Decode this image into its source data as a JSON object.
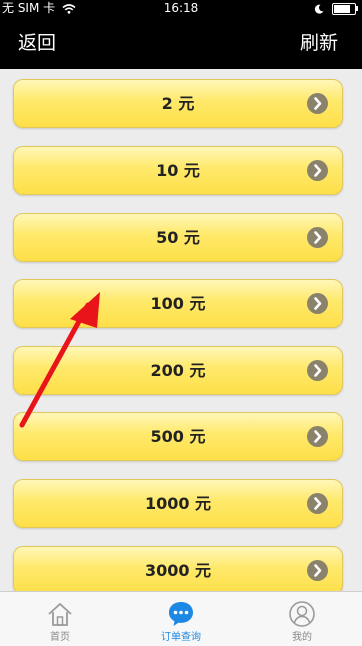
{
  "status_bar": {
    "carrier": "无 SIM 卡",
    "time": "16:18"
  },
  "nav": {
    "back_label": "返回",
    "refresh_label": "刷新"
  },
  "amounts": [
    {
      "label": "2 元"
    },
    {
      "label": "10 元"
    },
    {
      "label": "50 元"
    },
    {
      "label": "100 元"
    },
    {
      "label": "200 元"
    },
    {
      "label": "500 元"
    },
    {
      "label": "1000 元"
    },
    {
      "label": "3000 元"
    }
  ],
  "tabbar": {
    "tabs": [
      {
        "label": "首页",
        "icon": "home-icon",
        "active": false
      },
      {
        "label": "订单查询",
        "icon": "chat-icon",
        "active": true
      },
      {
        "label": "我的",
        "icon": "user-icon",
        "active": false
      }
    ]
  },
  "colors": {
    "header_bg": "#000000",
    "button_yellow": "#fde85a",
    "chevron_badge": "#8a826b",
    "active_tab": "#1e88e5",
    "arrow_annotation": "#e8141a"
  }
}
